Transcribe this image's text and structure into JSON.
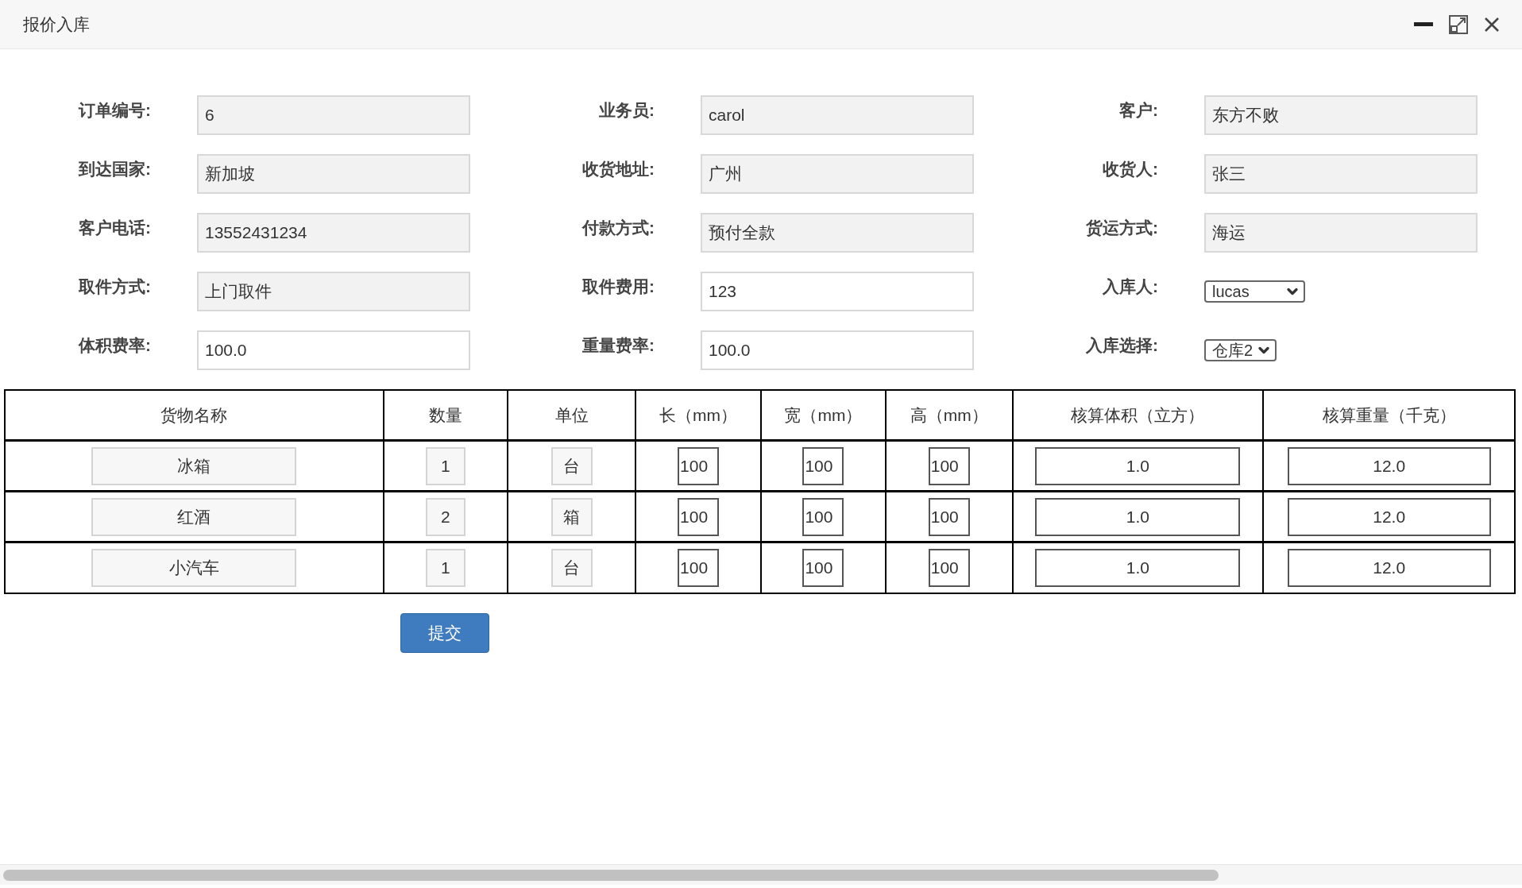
{
  "window": {
    "title": "报价入库"
  },
  "form": [
    {
      "label": "订单编号:",
      "kind": "text",
      "value": "6"
    },
    {
      "label": "业务员:",
      "kind": "text",
      "value": "carol"
    },
    {
      "label": "客户:",
      "kind": "text",
      "value": "东方不败"
    },
    {
      "label": "到达国家:",
      "kind": "text",
      "value": "新加坡"
    },
    {
      "label": "收货地址:",
      "kind": "text",
      "value": "广州"
    },
    {
      "label": "收货人:",
      "kind": "text",
      "value": "张三"
    },
    {
      "label": "客户电话:",
      "kind": "text",
      "value": "13552431234"
    },
    {
      "label": "付款方式:",
      "kind": "text",
      "value": "预付全款"
    },
    {
      "label": "货运方式:",
      "kind": "text",
      "value": "海运"
    },
    {
      "label": "取件方式:",
      "kind": "text",
      "value": "上门取件"
    },
    {
      "label": "取件费用:",
      "kind": "editable",
      "value": "123"
    },
    {
      "label": "入库人:",
      "kind": "select",
      "value": "lucas"
    },
    {
      "label": "体积费率:",
      "kind": "editable",
      "value": "100.0"
    },
    {
      "label": "重量费率:",
      "kind": "editable",
      "value": "100.0"
    },
    {
      "label": "入库选择:",
      "kind": "select",
      "value": "仓库2"
    }
  ],
  "table": {
    "columns": [
      "货物名称",
      "数量",
      "单位",
      "长（mm）",
      "宽（mm）",
      "高（mm）",
      "核算体积（立方）",
      "核算重量（千克）"
    ],
    "rows": [
      [
        "冰箱",
        "1",
        "台",
        "100",
        "100",
        "100",
        "1.0",
        "12.0"
      ],
      [
        "红酒",
        "2",
        "箱",
        "100",
        "100",
        "100",
        "1.0",
        "12.0"
      ],
      [
        "小汽车",
        "1",
        "台",
        "100",
        "100",
        "100",
        "1.0",
        "12.0"
      ]
    ]
  },
  "submit": "提交"
}
